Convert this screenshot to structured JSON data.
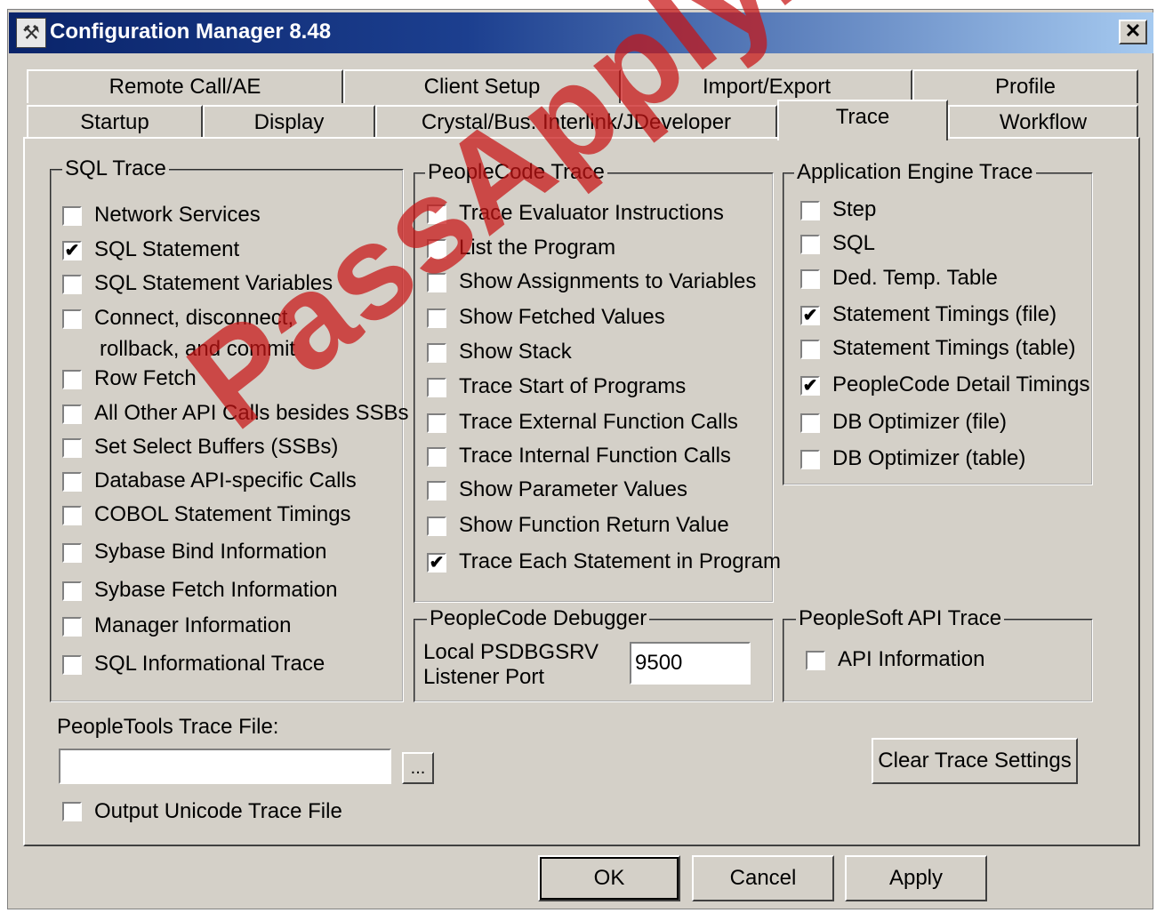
{
  "window": {
    "title": "Configuration Manager 8.48",
    "close_glyph": "✕"
  },
  "tabs_row_top": [
    {
      "label": "Remote Call/AE"
    },
    {
      "label": "Client Setup"
    },
    {
      "label": "Import/Export"
    },
    {
      "label": "Profile"
    }
  ],
  "tabs_row_bottom": [
    {
      "label": "Startup"
    },
    {
      "label": "Display"
    },
    {
      "label": "Crystal/Bus. Interlink/JDeveloper"
    },
    {
      "label": "Trace",
      "active": true
    },
    {
      "label": "Workflow"
    }
  ],
  "sql_trace": {
    "title": "SQL Trace",
    "items": [
      {
        "label": "Network Services",
        "checked": false
      },
      {
        "label": "SQL Statement",
        "checked": true
      },
      {
        "label": "SQL Statement Variables",
        "checked": false
      },
      {
        "label": "Connect, disconnect,",
        "label2": "rollback, and commit",
        "checked": false
      },
      {
        "label": "Row Fetch",
        "checked": false
      },
      {
        "label": "All Other API Calls besides SSBs",
        "checked": false
      },
      {
        "label": "Set Select Buffers (SSBs)",
        "checked": false
      },
      {
        "label": "Database API-specific Calls",
        "checked": false
      },
      {
        "label": "COBOL Statement Timings",
        "checked": false
      },
      {
        "label": "Sybase Bind Information",
        "checked": false
      },
      {
        "label": "Sybase Fetch Information",
        "checked": false
      },
      {
        "label": "Manager Information",
        "checked": false
      },
      {
        "label": "SQL Informational Trace",
        "checked": false
      }
    ]
  },
  "peoplecode_trace": {
    "title": "PeopleCode Trace",
    "items": [
      {
        "label": "Trace Evaluator Instructions",
        "checked": false
      },
      {
        "label": "List the Program",
        "checked": false
      },
      {
        "label": "Show Assignments to Variables",
        "checked": false
      },
      {
        "label": "Show Fetched Values",
        "checked": false
      },
      {
        "label": "Show Stack",
        "checked": false
      },
      {
        "label": "Trace Start of Programs",
        "checked": false
      },
      {
        "label": "Trace External Function Calls",
        "checked": false
      },
      {
        "label": "Trace Internal Function Calls",
        "checked": false
      },
      {
        "label": "Show Parameter Values",
        "checked": false
      },
      {
        "label": "Show Function Return Value",
        "checked": false
      },
      {
        "label": "Trace Each Statement in Program",
        "checked": true
      }
    ]
  },
  "ae_trace": {
    "title": "Application Engine Trace",
    "items": [
      {
        "label": "Step",
        "checked": false
      },
      {
        "label": "SQL",
        "checked": false
      },
      {
        "label": "Ded. Temp. Table",
        "checked": false
      },
      {
        "label": "Statement Timings (file)",
        "checked": true
      },
      {
        "label": "Statement Timings (table)",
        "checked": false
      },
      {
        "label": "PeopleCode Detail Timings",
        "checked": true
      },
      {
        "label": "DB Optimizer (file)",
        "checked": false
      },
      {
        "label": "DB Optimizer (table)",
        "checked": false
      }
    ]
  },
  "debugger": {
    "title": "PeopleCode Debugger",
    "port_label_1": "Local PSDBGSRV",
    "port_label_2": "Listener Port",
    "port_value": "9500"
  },
  "api_trace": {
    "title": "PeopleSoft API Trace",
    "items": [
      {
        "label": "API Information",
        "checked": false
      }
    ]
  },
  "trace_file": {
    "label": "PeopleTools Trace File:",
    "value": "",
    "browse_label": "...",
    "unicode_label": "Output Unicode Trace File",
    "unicode_checked": false
  },
  "clear_button": "Clear Trace Settings",
  "footer": {
    "ok": "OK",
    "cancel": "Cancel",
    "apply": "Apply"
  },
  "watermark": "PassApply.com",
  "colors": {
    "title_start": "#0a246a",
    "title_end": "#a6caf0",
    "face": "#d4d0c8",
    "watermark": "#c81414"
  }
}
